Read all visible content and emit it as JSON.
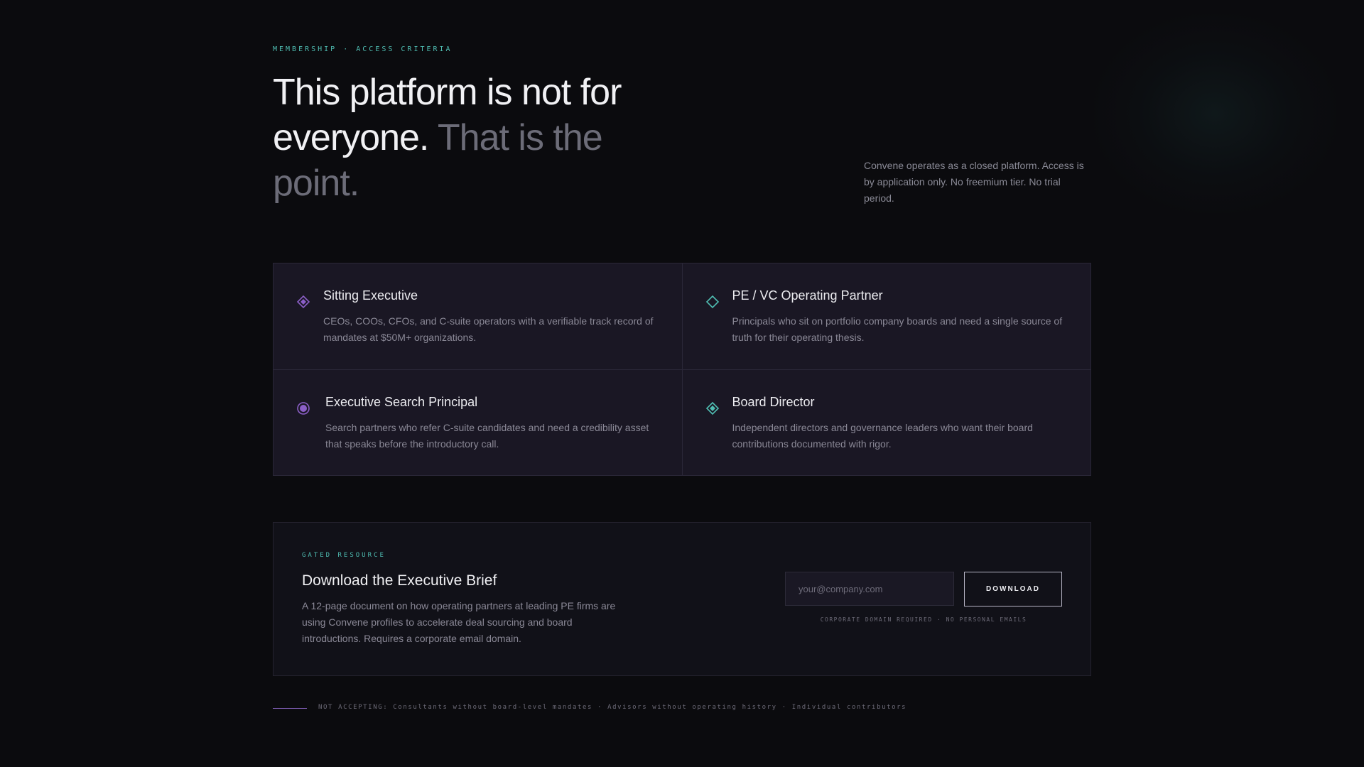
{
  "header": {
    "eyebrow": "MEMBERSHIP · ACCESS CRITERIA",
    "headline_main": "This platform is not for everyone.",
    "headline_muted": "That is the point.",
    "intro": "Convene operates as a closed platform. Access is by application only. No freemium tier. No trial period."
  },
  "criteria": [
    {
      "icon": "diamond-filled-purple-icon",
      "title": "Sitting Executive",
      "description": "CEOs, COOs, CFOs, and C-suite operators with a verifiable track record of mandates at $50M+ organizations."
    },
    {
      "icon": "diamond-outline-teal-icon",
      "title": "PE / VC Operating Partner",
      "description": "Principals who sit on portfolio company boards and need a single source of truth for their operating thesis."
    },
    {
      "icon": "circle-target-purple-icon",
      "title": "Executive Search Principal",
      "description": "Search partners who refer C-suite candidates and need a credibility asset that speaks before the introductory call."
    },
    {
      "icon": "diamond-filled-teal-icon",
      "title": "Board Director",
      "description": "Independent directors and governance leaders who want their board contributions documented with rigor."
    }
  ],
  "brief": {
    "eyebrow": "GATED RESOURCE",
    "title": "Download the Executive Brief",
    "description": "A 12-page document on how operating partners at leading PE firms are using Convene profiles to accelerate deal sourcing and board introductions. Requires a corporate email domain.",
    "email_placeholder": "your@company.com",
    "email_value": "",
    "download_label": "DOWNLOAD",
    "note": "CORPORATE DOMAIN REQUIRED · NO PERSONAL EMAILS"
  },
  "footer": {
    "note": "NOT ACCEPTING: Consultants without board-level mandates · Advisors without operating history · Individual contributors"
  },
  "colors": {
    "background": "#0b0b0e",
    "accent_teal": "#4fbdb2",
    "accent_purple": "#8b5fc7",
    "card_bg": "#1a1724"
  }
}
